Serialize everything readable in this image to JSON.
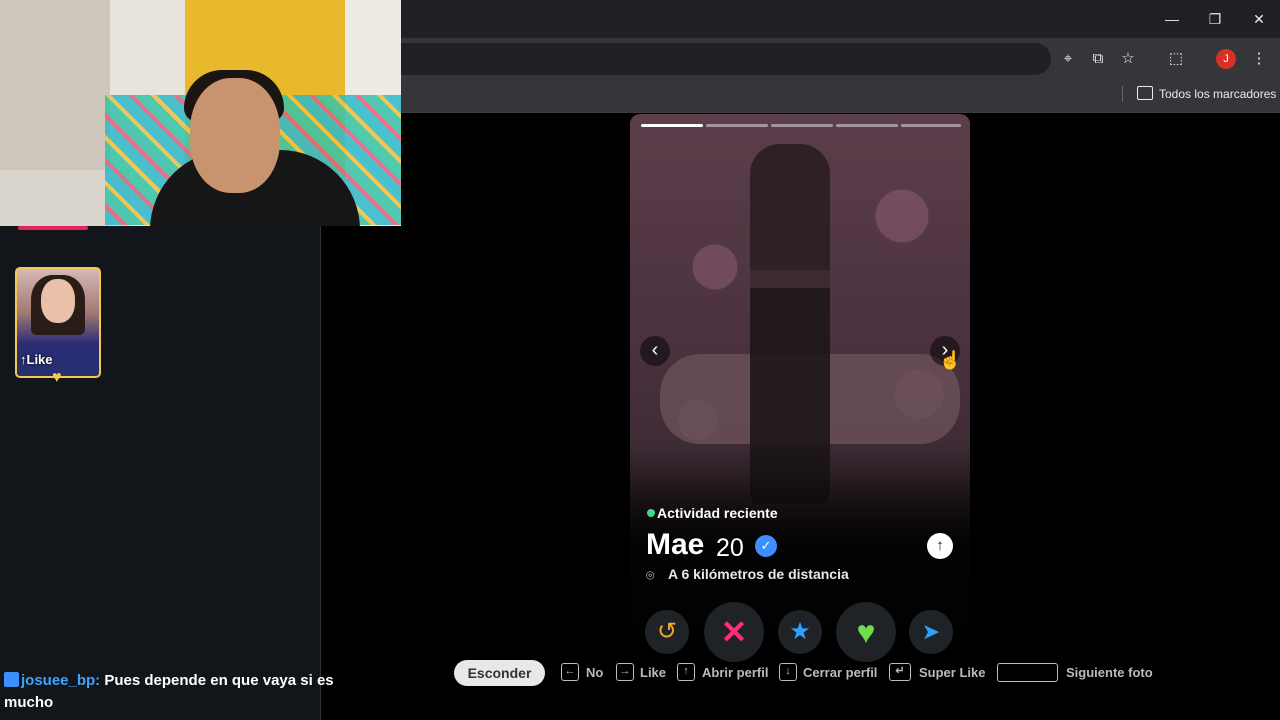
{
  "browser": {
    "bookmarks_label": "Todos los marcadores",
    "profile_initial": "J"
  },
  "stream": {
    "like_label": "Like",
    "chat": {
      "user": "josuee_bp:",
      "message": "Pues depende en que vaya si es mucho"
    }
  },
  "profile": {
    "status": "Actividad reciente",
    "name": "Mae",
    "age": "20",
    "distance": "A 6 kilómetros de distancia",
    "photo_count": 5,
    "current_photo": 1
  },
  "shortcuts": {
    "hide": "Esconder",
    "no": "No",
    "like": "Like",
    "open_profile": "Abrir perfil",
    "close_profile": "Cerrar perfil",
    "super_like": "Super Like",
    "next_photo": "Siguiente foto"
  },
  "colors": {
    "nope": "#ff2d73",
    "like": "#6ce04c",
    "super": "#2ea1ff",
    "rewind": "#f5a623",
    "online": "#3ddc84",
    "verified": "#3d8eff"
  }
}
